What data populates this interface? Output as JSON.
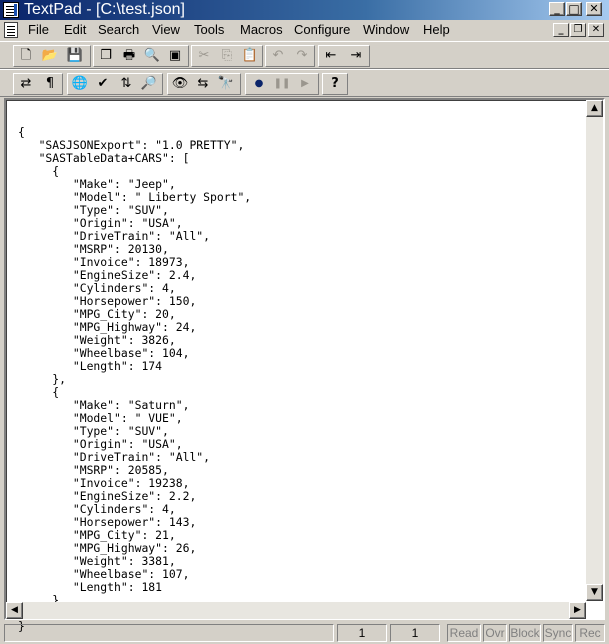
{
  "window": {
    "title": "TextPad - [C:\\test.json]",
    "minimize": "_",
    "maximize": "□",
    "close": "✕"
  },
  "menu": {
    "items": [
      "File",
      "Edit",
      "Search",
      "View",
      "Tools",
      "Macros",
      "Configure",
      "Window",
      "Help"
    ],
    "doc_minimize": "_",
    "doc_restore": "❐",
    "doc_close": "✕"
  },
  "toolbar1": {
    "icons": [
      "new-file-icon",
      "open-folder-icon",
      "save-icon",
      "multi-document-icon",
      "print-icon",
      "print-preview-icon",
      "document-view-icon",
      "cut-icon",
      "copy-icon",
      "paste-icon",
      "undo-icon",
      "redo-icon",
      "outdent-icon",
      "indent-icon"
    ],
    "glyphs": [
      "🗋",
      "📂",
      "💾",
      "❐",
      "🖶",
      "🔍",
      "▣",
      "✂",
      "⎘",
      "📋",
      "↶",
      "↷",
      "⇤",
      "⇥"
    ]
  },
  "toolbar2": {
    "icons": [
      "word-wrap-icon",
      "paragraph-icon",
      "web-globe-icon",
      "spell-check-icon",
      "sort-icon",
      "find-in-files-icon",
      "view-visible-icon",
      "replace-icon",
      "binoculars-icon",
      "record-macro-icon",
      "pause-macro-icon",
      "play-macro-icon",
      "context-help-icon"
    ],
    "glyphs": [
      "⇄",
      "¶",
      "🌐",
      "✔",
      "⇅",
      "🔎",
      "👁",
      "⇆",
      "🔭",
      "●",
      "❚❚",
      "▶",
      "?"
    ]
  },
  "editor": {
    "lines": [
      "{",
      "   \"SASJSONExport\": \"1.0 PRETTY\",",
      "   \"SASTableData+CARS\": [",
      "     {",
      "        \"Make\": \"Jeep\",",
      "        \"Model\": \" Liberty Sport\",",
      "        \"Type\": \"SUV\",",
      "        \"Origin\": \"USA\",",
      "        \"DriveTrain\": \"All\",",
      "        \"MSRP\": 20130,",
      "        \"Invoice\": 18973,",
      "        \"EngineSize\": 2.4,",
      "        \"Cylinders\": 4,",
      "        \"Horsepower\": 150,",
      "        \"MPG_City\": 20,",
      "        \"MPG_Highway\": 24,",
      "        \"Weight\": 3826,",
      "        \"Wheelbase\": 104,",
      "        \"Length\": 174",
      "     },",
      "     {",
      "        \"Make\": \"Saturn\",",
      "        \"Model\": \" VUE\",",
      "        \"Type\": \"SUV\",",
      "        \"Origin\": \"USA\",",
      "        \"DriveTrain\": \"All\",",
      "        \"MSRP\": 20585,",
      "        \"Invoice\": 19238,",
      "        \"EngineSize\": 2.2,",
      "        \"Cylinders\": 4,",
      "        \"Horsepower\": 143,",
      "        \"MPG_City\": 21,",
      "        \"MPG_Highway\": 26,",
      "        \"Weight\": 3381,",
      "        \"Wheelbase\": 107,",
      "        \"Length\": 181",
      "     }",
      "   ]",
      "}"
    ]
  },
  "scrollbars": {
    "up": "▲",
    "down": "▼",
    "left": "◀",
    "right": "▶"
  },
  "status": {
    "line": "1",
    "column": "1",
    "read": "Read",
    "ovr": "Ovr",
    "block": "Block",
    "sync": "Sync",
    "rec": "Rec"
  }
}
